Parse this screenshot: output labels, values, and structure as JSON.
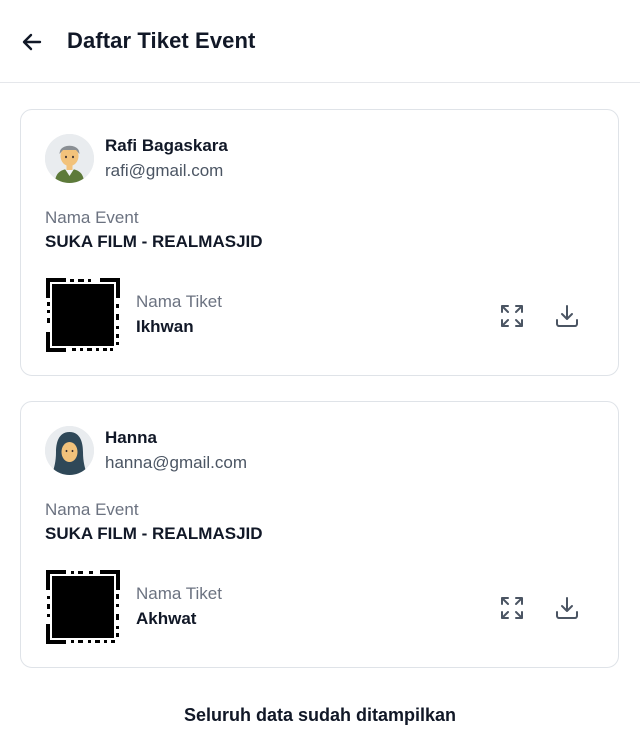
{
  "header": {
    "title": "Daftar Tiket Event",
    "back_icon": "arrow-left-icon"
  },
  "tickets": [
    {
      "user_name": "Rafi Bagaskara",
      "user_email": "rafi@gmail.com",
      "avatar_icon": "male-avatar-icon",
      "event_label": "Nama Event",
      "event_name": "SUKA FILM - REALMASJID",
      "ticket_label": "Nama Tiket",
      "ticket_name": "Ikhwan",
      "expand_icon": "expand-icon",
      "download_icon": "download-icon"
    },
    {
      "user_name": "Hanna",
      "user_email": "hanna@gmail.com",
      "avatar_icon": "female-avatar-icon",
      "event_label": "Nama Event",
      "event_name": "SUKA FILM - REALMASJID",
      "ticket_label": "Nama Tiket",
      "ticket_name": "Akhwat",
      "expand_icon": "expand-icon",
      "download_icon": "download-icon"
    }
  ],
  "footer": {
    "message": "Seluruh data sudah ditampilkan"
  },
  "colors": {
    "border": "#dfe3e8",
    "muted_text": "#6b7280",
    "icon": "#4b5563"
  }
}
